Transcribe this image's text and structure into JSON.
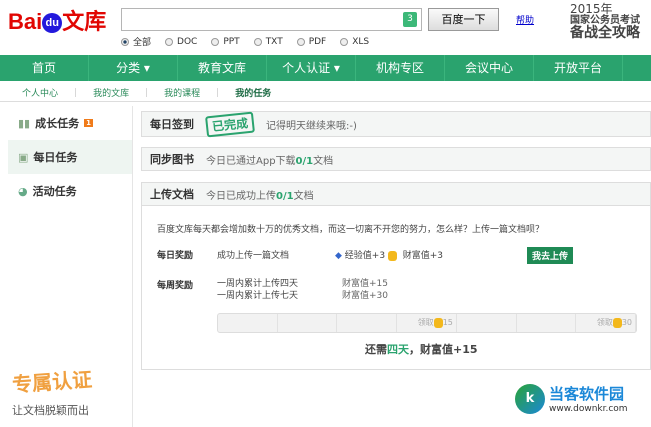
{
  "header": {
    "logo_bai": "Bai",
    "logo_du": "du",
    "logo_wenku": "文库",
    "search_value": "",
    "search_badge": "3",
    "search_button": "百度一下",
    "help": "帮助",
    "promo": {
      "year": "2015年",
      "line1": "国家公务员考试",
      "line2": "备战全攻略"
    },
    "filters": [
      {
        "label": "全部",
        "selected": true
      },
      {
        "label": "DOC",
        "selected": false
      },
      {
        "label": "PPT",
        "selected": false
      },
      {
        "label": "TXT",
        "selected": false
      },
      {
        "label": "PDF",
        "selected": false
      },
      {
        "label": "XLS",
        "selected": false
      }
    ]
  },
  "nav": [
    "首页",
    "分类 ▾",
    "教育文库",
    "个人认证 ▾",
    "机构专区",
    "会议中心",
    "开放平台"
  ],
  "subnav": [
    "个人中心",
    "我的文库",
    "我的课程",
    "我的任务"
  ],
  "sidebar": {
    "items": [
      {
        "label": "成长任务",
        "badge": "1"
      },
      {
        "label": "每日任务"
      },
      {
        "label": "活动任务"
      }
    ],
    "promo_title": "专属认证",
    "promo_sub": "让文档脱颖而出"
  },
  "tasks": {
    "checkin": {
      "title": "每日签到",
      "stamp": "已完成",
      "text": "记得明天继续来哦:-)"
    },
    "sync": {
      "title": "同步图书",
      "text_pre": "今日已通过App下载",
      "progress": "0/1",
      "text_post": "文档"
    },
    "upload": {
      "title": "上传文档",
      "text_pre": "今日已成功上传",
      "progress": "0/1",
      "text_post": "文档",
      "intro": "百度文库每天都会增加数十万的优秀文档，而这一切离不开您的努力，怎么样？上传一篇文档呗？",
      "daily_label": "每日奖励",
      "daily_task": "成功上传一篇文档",
      "exp": "经验值+3",
      "wealth": "财富值+3",
      "go_button": "我去上传",
      "weekly_label": "每周奖励",
      "weekly": [
        {
          "task": "一周内累计上传四天",
          "reward": "财富值+15"
        },
        {
          "task": "一周内累计上传七天",
          "reward": "财富值+30"
        }
      ],
      "track": [
        {
          "label": ""
        },
        {
          "label": ""
        },
        {
          "label": ""
        },
        {
          "label": "领取",
          "amount": "15"
        },
        {
          "label": ""
        },
        {
          "label": ""
        },
        {
          "label": "领取",
          "amount": "30"
        }
      ],
      "remain_pre": "还需",
      "remain_days": "四天",
      "remain_post": "，财富值+15"
    }
  },
  "watermark": {
    "name": "当客软件园",
    "url": "www.downkr.com"
  }
}
